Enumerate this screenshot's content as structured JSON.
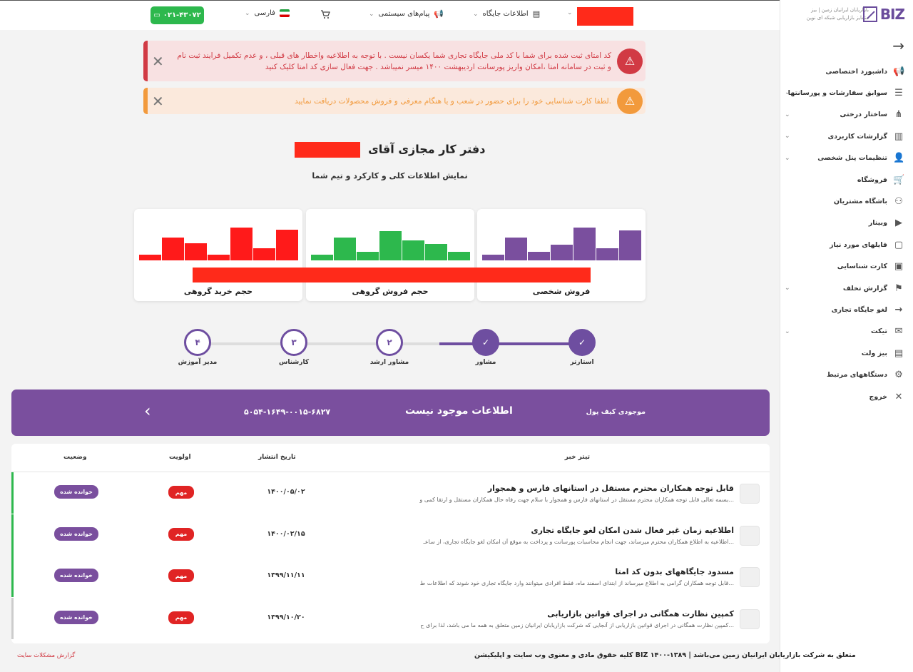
{
  "topbar": {
    "phone": "۰۲۱-۴۳۰۷۲",
    "language": "فارسی",
    "messages": "پیام‌های سیستمی",
    "station_info": "اطلاعات جایگاه"
  },
  "sidebar": {
    "brand": "BIZ",
    "brand_sub": "بازاریابان ایرانیان زمین | بیز\nمتمایز بازاریابی شبکه ای نوین",
    "items": [
      {
        "label": "داشبورد اختصاصی",
        "icon": "megaphone-icon",
        "chevron": false
      },
      {
        "label": "سوابق سفارشات و پورسانتها",
        "icon": "list-icon",
        "chevron": true
      },
      {
        "label": "ساختار درختی",
        "icon": "tree-icon",
        "chevron": true
      },
      {
        "label": "گزارشات کاربردی",
        "icon": "chart-icon",
        "chevron": true
      },
      {
        "label": "تنظیمات پنل شخصی",
        "icon": "user-icon",
        "chevron": true
      },
      {
        "label": "فروشگاه",
        "icon": "cart-icon",
        "chevron": false
      },
      {
        "label": "باشگاه مشتریان",
        "icon": "club-icon",
        "chevron": false
      },
      {
        "label": "وبینار",
        "icon": "video-icon",
        "chevron": false
      },
      {
        "label": "فایلهای مورد نیاز",
        "icon": "file-icon",
        "chevron": false
      },
      {
        "label": "کارت شناسایی",
        "icon": "id-card-icon",
        "chevron": false
      },
      {
        "label": "گزارش تخلف",
        "icon": "report-icon",
        "chevron": true
      },
      {
        "label": "لغو جایگاه تجاری",
        "icon": "arrow-icon",
        "chevron": false
      },
      {
        "label": "تیکت",
        "icon": "ticket-icon",
        "chevron": true
      },
      {
        "label": "بیز ولت",
        "icon": "wallet-icon",
        "chevron": false
      },
      {
        "label": "دستگاههای مرتبط",
        "icon": "device-icon",
        "chevron": false
      },
      {
        "label": "خروج",
        "icon": "close-icon",
        "chevron": false
      }
    ]
  },
  "alerts": {
    "red": "کد امتای ثبت شده برای شما با کد ملی جایگاه تجاری شما یکسان نیست . با توجه به اطلاعیه واخطار های قبلی ، و عدم تکمیل فرایند ثبت نام و ثبت در سامانه امتا ،امکان واریز پورسانت اردیبهشت ۱۴۰۰ میسر نمیباشد . جهت فعال سازی کد امتا کلیک کنید",
    "orange": "لطفا کارت شناسایی خود را برای حضور در شعب و یا هنگام معرفی و فروش محصولات دریافت نمایید."
  },
  "page": {
    "title": "دفتر کار مجازی آقای",
    "subtitle": "نمایش اطلاعات کلی و کارکرد و تیم شما"
  },
  "cards": [
    {
      "label": "فروش شخصی",
      "color": "#7a4f9e"
    },
    {
      "label": "حجم فروش گروهی",
      "color": "#2db84d"
    },
    {
      "label": "حجم خرید  گروهی",
      "color": "#ff1a1a"
    }
  ],
  "steps": [
    {
      "label": "استارتر",
      "value": "✓",
      "done": true
    },
    {
      "label": "مشاور",
      "value": "✓",
      "done": true
    },
    {
      "label": "مشاور ارشد",
      "value": "۲",
      "done": false
    },
    {
      "label": "کارشناس",
      "value": "۳",
      "done": false
    },
    {
      "label": "مدیر آموزش",
      "value": "۴",
      "done": false
    }
  ],
  "wallet": {
    "label": "موجودی کیف پول",
    "status": "اطلاعات موجود نیست",
    "number": "۵۰۵۴-۱۶۴۹-۰۰۱۵-۶۸۲۷"
  },
  "table": {
    "headers": {
      "title": "تیتر خبر",
      "date": "تاریخ انتشار",
      "priority": "اولویت",
      "status": "وضعیت"
    },
    "rows": [
      {
        "title": "قابل توجه همکاران محترم مستقل در استانهای فارس و همجوار",
        "desc": "بسمه تعالی قابل توجه همکاران محترم مستقل در استانهای فارس و همجوار با سلام جهت رفاه حال همکاران مستقل و ارتقا کمی و...",
        "date": "۱۴۰۰/۰۵/۰۲",
        "priority": "مهم",
        "status": "خوانده شده",
        "marker": "#2db84d"
      },
      {
        "title": "اطلاعیه زمان غیر فعال شدن امکان لغو جایگاه تجاری",
        "desc": "اطلاعیه به اطلاع همکاران محترم میرساند، جهت انجام محاسبات پورسانت و پرداخت به موقع آن امکان لغو جایگاه تجاری، از ساعـ...",
        "date": "۱۴۰۰/۰۲/۱۵",
        "priority": "مهم",
        "status": "خوانده شده",
        "marker": "#2db84d"
      },
      {
        "title": "مسدود جایگاههای بدون کد امتا",
        "desc": "قابل توجه همکاران گرامی به اطلاع میرساند از ابتدای اسفند ماه، فقط افرادی میتوانند وارد جایگاه تجاری خود شوند که اطلاعات ط...",
        "date": "۱۳۹۹/۱۱/۱۱",
        "priority": "مهم",
        "status": "خوانده شده",
        "marker": "#2db84d"
      },
      {
        "title": "کمپین نظارت همگانی در اجرای قوانین بازاریابی",
        "desc": "کمپین نظارت همگانی در اجرای قوانین بازاریابی از آنجایی که شرکت بازاریابان ایرانیان زمین متعلق به همه ما می باشد، لذا برای ح...",
        "date": "۱۳۹۹/۱۰/۲۰",
        "priority": "مهم",
        "status": "خوانده شده",
        "marker": "#cccccc"
      }
    ]
  },
  "footer": {
    "copyright": "کلیه حقوق مادی و معنوی وب سایت و اپلیکیشن BIZ متعلق به شرکت بازاریابان ایرانیان زمین می‌باشد | ۱۳۸۹-۱۴۰۰",
    "report_link": "گزارش مشکلات سایت"
  }
}
